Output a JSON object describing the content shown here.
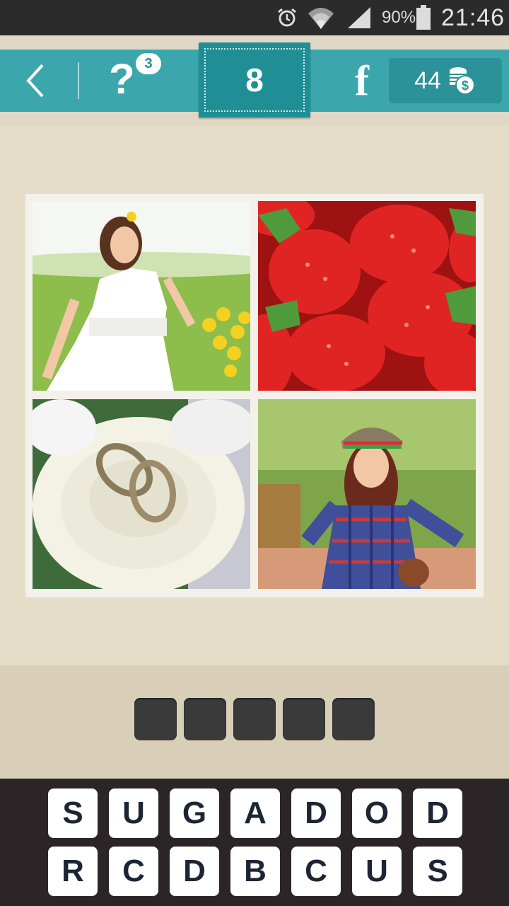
{
  "status_bar": {
    "battery_percent": "90%",
    "time": "21:46",
    "icons": [
      "alarm-icon",
      "wifi-icon",
      "signal-icon",
      "battery-icon"
    ]
  },
  "toolbar": {
    "back_icon": "chevron-left-icon",
    "hint_symbol": "?",
    "hint_count": "3",
    "level": "8",
    "facebook_label": "f",
    "coins": "44",
    "coins_icon": "coin-stack-icon"
  },
  "puzzle": {
    "images": [
      "woman-in-white-dress-with-flowers",
      "strawberries",
      "wedding-rings-on-white-rose",
      "woman-in-hat-and-plaid-shirt"
    ]
  },
  "answer": {
    "slot_count": 5
  },
  "keyboard": {
    "row1": [
      "S",
      "U",
      "G",
      "A",
      "D",
      "O",
      "D"
    ],
    "row2": [
      "R",
      "C",
      "D",
      "B",
      "C",
      "U",
      "S"
    ]
  },
  "colors": {
    "toolbar": "#3ba7ac",
    "level_box": "#1f8f95",
    "background": "#e6ddc9",
    "keyboard_bg": "#2b2528",
    "slot": "#3a3a3a"
  }
}
